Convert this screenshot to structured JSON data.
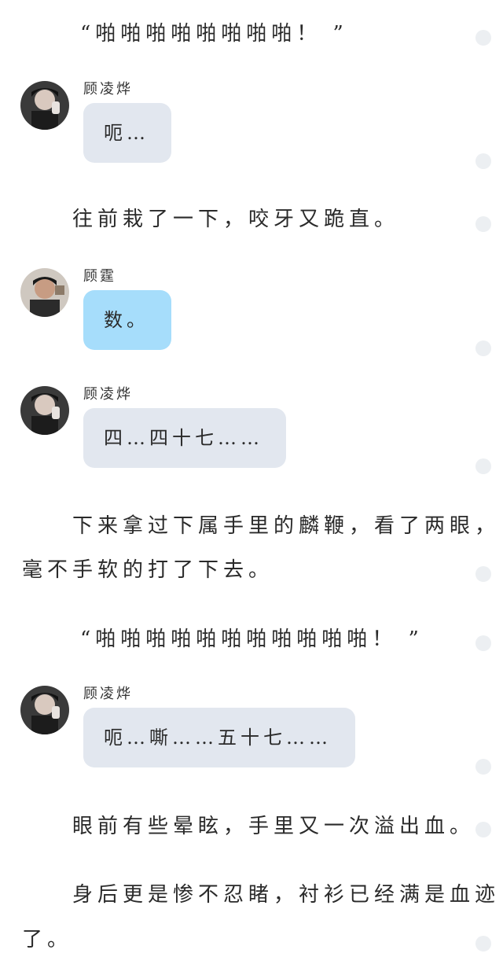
{
  "story": [
    "“啪啪啪啪啪啪啪啪！ ”",
    "往前栽了一下，咬牙又跪直。",
    "下来拿过下属手里的麟鞭，看了两眼，",
    "毫不手软的打了下去。",
    "“啪啪啪啪啪啪啪啪啪啪啪！ ”",
    "眼前有些晕眩，手里又一次溢出血。",
    "身后更是惨不忍睹，衬衫已经满是血迹",
    "了。"
  ],
  "messages": [
    {
      "name": "顾凌烨",
      "text": "呃…",
      "color": "gray",
      "avatar": "avatar-gu-lingye"
    },
    {
      "name": "顾霆",
      "text": "数。",
      "color": "blue",
      "avatar": "avatar-gu-ting"
    },
    {
      "name": "顾凌烨",
      "text": "四…四十七……",
      "color": "gray",
      "avatar": "avatar-gu-lingye"
    },
    {
      "name": "顾凌烨",
      "text": "呃…嘶……五十七……",
      "color": "gray",
      "avatar": "avatar-gu-lingye"
    }
  ],
  "colors": {
    "bubble_gray": "#e2e7ef",
    "bubble_blue": "#a6ddfb",
    "side_dot": "#eceff2"
  }
}
